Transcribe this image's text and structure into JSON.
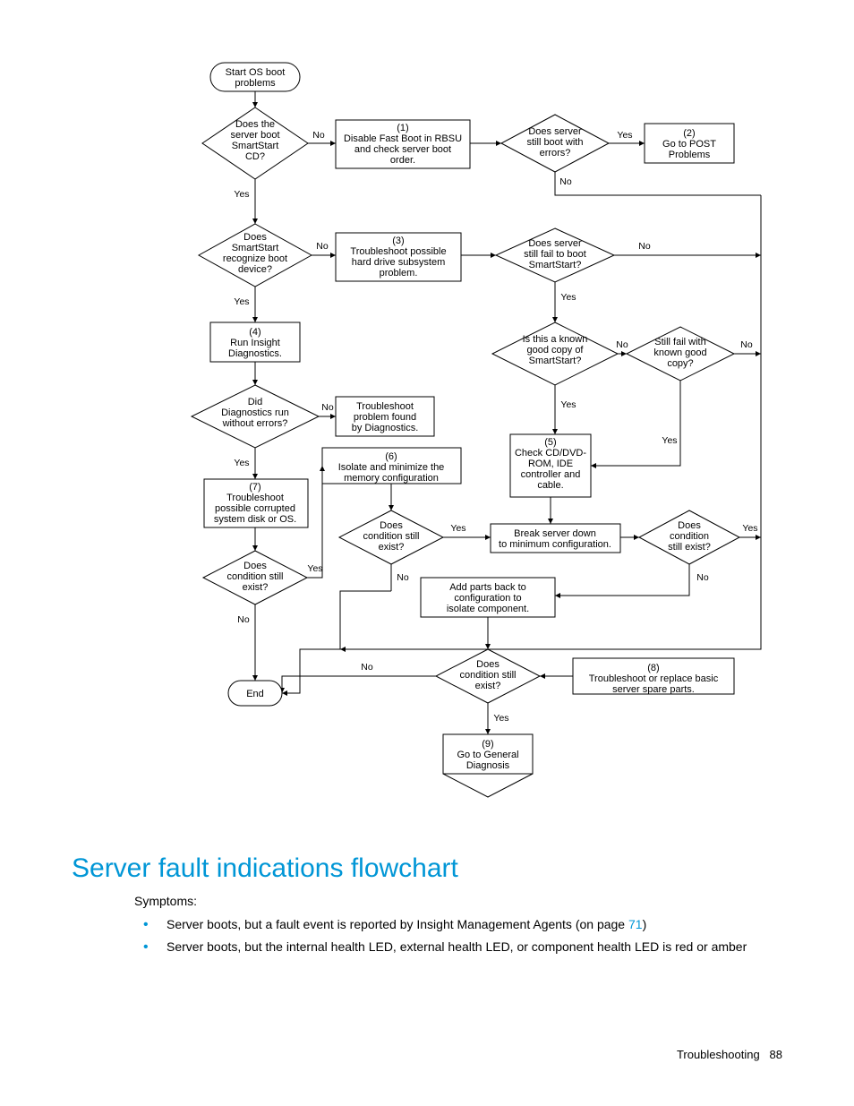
{
  "flowchart": {
    "nodes": {
      "start": [
        "Start OS boot",
        "problems"
      ],
      "d1": [
        "Does the",
        "server boot",
        "SmartStart",
        "CD?"
      ],
      "p1": [
        "(1)",
        "Disable Fast Boot in RBSU",
        "and check server boot",
        "order."
      ],
      "d_errors": [
        "Does server",
        "still boot with",
        "errors?"
      ],
      "p2": [
        "(2)",
        "Go to POST",
        "Problems"
      ],
      "d_recognize": [
        "Does",
        "SmartStart",
        "recognize boot",
        "device?"
      ],
      "p3": [
        "(3)",
        "Troubleshoot possible",
        "hard drive subsystem",
        "problem."
      ],
      "d_failboot": [
        "Does server",
        "still fail to boot",
        "SmartStart?"
      ],
      "p4": [
        "(4)",
        "Run Insight",
        "Diagnostics."
      ],
      "d_known": [
        "Is this a known",
        "good copy of",
        "SmartStart?"
      ],
      "d_knowncopy": [
        "Still fail with",
        "known good",
        "copy?"
      ],
      "d_diag": [
        "Did",
        "Diagnostics run",
        "without errors?"
      ],
      "p_diag": [
        "Troubleshoot",
        "problem found",
        "by Diagnostics."
      ],
      "p5": [
        "(5)",
        "Check CD/DVD-",
        "ROM, IDE",
        "controller and",
        "cable."
      ],
      "p6": [
        "(6)",
        "Isolate and minimize the",
        "memory configuration"
      ],
      "p7": [
        "(7)",
        "Troubleshoot",
        "possible corrupted",
        "system disk or OS."
      ],
      "d_cond1": [
        "Does",
        "condition still",
        "exist?"
      ],
      "d_cond_left": [
        "Does",
        "condition still",
        "exist?"
      ],
      "d_cond_right": [
        "Does",
        "condition",
        "still exist?"
      ],
      "p_break": [
        "Break server down",
        "to minimum configuration."
      ],
      "p_add": [
        "Add parts back to",
        "configuration to",
        "isolate component."
      ],
      "d_cond2": [
        "Does",
        "condition still",
        "exist?"
      ],
      "p8": [
        "(8)",
        "Troubleshoot or replace basic",
        "server spare parts."
      ],
      "end": "End",
      "p9": [
        "(9)",
        "Go to General",
        "Diagnosis"
      ]
    },
    "labels": {
      "yes": "Yes",
      "no": "No"
    }
  },
  "heading": "Server fault indications flowchart",
  "symptoms_label": "Symptoms:",
  "bullets": {
    "b1a": "Server boots, but a fault event is reported by Insight Management Agents (on page ",
    "b1_link": "71",
    "b1b": ")",
    "b2": "Server boots, but the internal health LED, external health LED, or component health LED is red or amber"
  },
  "footer": {
    "section": "Troubleshooting",
    "page": "88"
  }
}
